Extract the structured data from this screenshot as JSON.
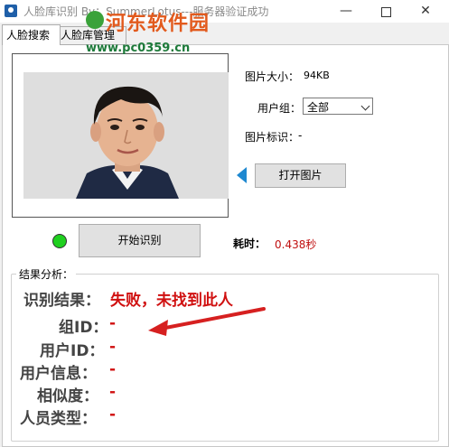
{
  "window": {
    "title": "人脸库识别 By：SummerLotus---服务器验证成功",
    "min_glyph": "—",
    "close_glyph": "✕"
  },
  "watermark": {
    "title": "河东软件园",
    "url": "www.pc0359.cn"
  },
  "tabs": [
    {
      "label": "人脸搜索",
      "selected": true
    },
    {
      "label": "人脸库管理",
      "selected": false
    }
  ],
  "info": {
    "size_label": "图片大小：",
    "size_value": "94KB",
    "group_label": "用户组：",
    "group_value": "全部",
    "id_label": "图片标识：",
    "id_value": "-"
  },
  "buttons": {
    "open_image": "打开图片",
    "start_recognize": "开始识别"
  },
  "timing": {
    "label": "耗时：",
    "value": "0.438秒"
  },
  "results": {
    "title": "结果分析：",
    "result_label": "识别结果：",
    "result_value": "失败，未找到此人",
    "group_id_label": "组ID：",
    "group_id_value": "-",
    "user_id_label": "用户ID：",
    "user_id_value": "-",
    "user_info_label": "用户信息：",
    "user_info_value": "-",
    "similarity_label": "相似度：",
    "similarity_value": "-",
    "person_type_label": "人员类型：",
    "person_type_value": "-"
  },
  "colors": {
    "status_dot": "#1fd01f",
    "result_red": "#d01010",
    "arrow_blue": "#1e88d0",
    "annotation_red": "#d62020"
  }
}
